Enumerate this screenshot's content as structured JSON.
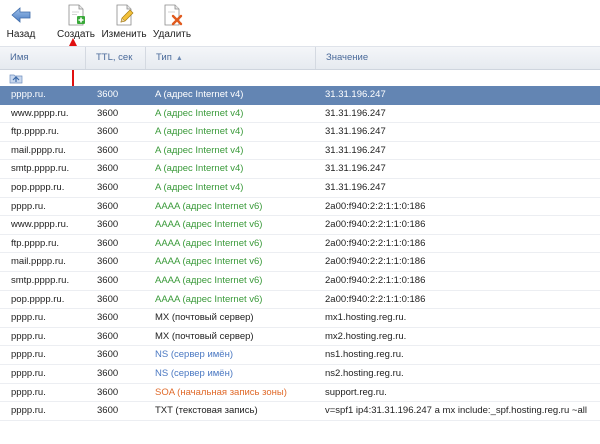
{
  "toolbar": {
    "back_label": "Назад",
    "create_label": "Создать",
    "edit_label": "Изменить",
    "delete_label": "Удалить"
  },
  "table": {
    "headers": {
      "name": "Имя",
      "ttl": "TTL, сек",
      "type": "Тип",
      "value": "Значение"
    },
    "rows": [
      {
        "name": "pppp.ru.",
        "ttl": "3600",
        "type": "A (адрес Internet v4)",
        "value": "31.31.196.247",
        "kind": "a",
        "selected": true
      },
      {
        "name": "www.pppp.ru.",
        "ttl": "3600",
        "type": "A (адрес Internet v4)",
        "value": "31.31.196.247",
        "kind": "a"
      },
      {
        "name": "ftp.pppp.ru.",
        "ttl": "3600",
        "type": "A (адрес Internet v4)",
        "value": "31.31.196.247",
        "kind": "a"
      },
      {
        "name": "mail.pppp.ru.",
        "ttl": "3600",
        "type": "A (адрес Internet v4)",
        "value": "31.31.196.247",
        "kind": "a"
      },
      {
        "name": "smtp.pppp.ru.",
        "ttl": "3600",
        "type": "A (адрес Internet v4)",
        "value": "31.31.196.247",
        "kind": "a"
      },
      {
        "name": "pop.pppp.ru.",
        "ttl": "3600",
        "type": "A (адрес Internet v4)",
        "value": "31.31.196.247",
        "kind": "a"
      },
      {
        "name": "pppp.ru.",
        "ttl": "3600",
        "type": "AAAA (адрес Internet v6)",
        "value": "2a00:f940:2:2:1:1:0:186",
        "kind": "a"
      },
      {
        "name": "www.pppp.ru.",
        "ttl": "3600",
        "type": "AAAA (адрес Internet v6)",
        "value": "2a00:f940:2:2:1:1:0:186",
        "kind": "a"
      },
      {
        "name": "ftp.pppp.ru.",
        "ttl": "3600",
        "type": "AAAA (адрес Internet v6)",
        "value": "2a00:f940:2:2:1:1:0:186",
        "kind": "a"
      },
      {
        "name": "mail.pppp.ru.",
        "ttl": "3600",
        "type": "AAAA (адрес Internet v6)",
        "value": "2a00:f940:2:2:1:1:0:186",
        "kind": "a"
      },
      {
        "name": "smtp.pppp.ru.",
        "ttl": "3600",
        "type": "AAAA (адрес Internet v6)",
        "value": "2a00:f940:2:2:1:1:0:186",
        "kind": "a"
      },
      {
        "name": "pop.pppp.ru.",
        "ttl": "3600",
        "type": "AAAA (адрес Internet v6)",
        "value": "2a00:f940:2:2:1:1:0:186",
        "kind": "a"
      },
      {
        "name": "pppp.ru.",
        "ttl": "3600",
        "type": "MX (почтовый сервер)",
        "value": "mx1.hosting.reg.ru.",
        "kind": "plain"
      },
      {
        "name": "pppp.ru.",
        "ttl": "3600",
        "type": "MX (почтовый сервер)",
        "value": "mx2.hosting.reg.ru.",
        "kind": "plain"
      },
      {
        "name": "pppp.ru.",
        "ttl": "3600",
        "type": "NS (сервер имён)",
        "value": "ns1.hosting.reg.ru.",
        "kind": "ns"
      },
      {
        "name": "pppp.ru.",
        "ttl": "3600",
        "type": "NS (сервер имён)",
        "value": "ns2.hosting.reg.ru.",
        "kind": "ns"
      },
      {
        "name": "pppp.ru.",
        "ttl": "3600",
        "type": "SOA (начальная запись зоны)",
        "value": "support.reg.ru.",
        "kind": "soa"
      },
      {
        "name": "pppp.ru.",
        "ttl": "3600",
        "type": "TXT (текстовая запись)",
        "value": "v=spf1 ip4:31.31.196.247 a mx include:_spf.hosting.reg.ru ~all",
        "kind": "plain"
      }
    ]
  },
  "colors": {
    "selected_row": "#6385b3",
    "type_a": "#3a9a3a",
    "type_ns": "#4a78c2",
    "type_soa": "#e06a2a",
    "header_text": "#4a6a9a",
    "annotation_arrow": "#e01010"
  },
  "icons": {
    "back": "arrow-left-icon",
    "create": "new-document-plus-icon",
    "edit": "edit-document-pencil-icon",
    "delete": "delete-document-x-icon",
    "up": "folder-up-icon",
    "sort": "sort-ascending-icon"
  }
}
